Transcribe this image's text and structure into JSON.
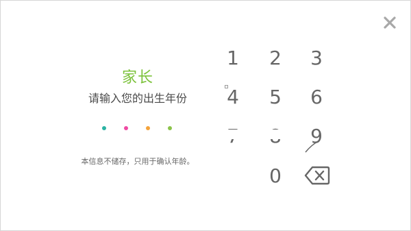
{
  "prompt": {
    "title": "家长",
    "subtitle": "请输入您的出生年份",
    "note": "本信息不储存，只用于确认年龄。"
  },
  "pin_dots": {
    "colors": [
      "#2bb3a3",
      "#ef4aa3",
      "#f4a33a",
      "#8bc34a"
    ]
  },
  "keypad": {
    "k1": "1",
    "k2": "2",
    "k3": "3",
    "k4": "4",
    "k5": "5",
    "k6": "6",
    "k7": "7",
    "k8": "8",
    "k9": "9",
    "k0": "0"
  },
  "colors": {
    "accent": "#7cc23b",
    "keys": "#666666"
  },
  "icons": {
    "close": "close-icon",
    "backspace": "backspace-icon"
  }
}
